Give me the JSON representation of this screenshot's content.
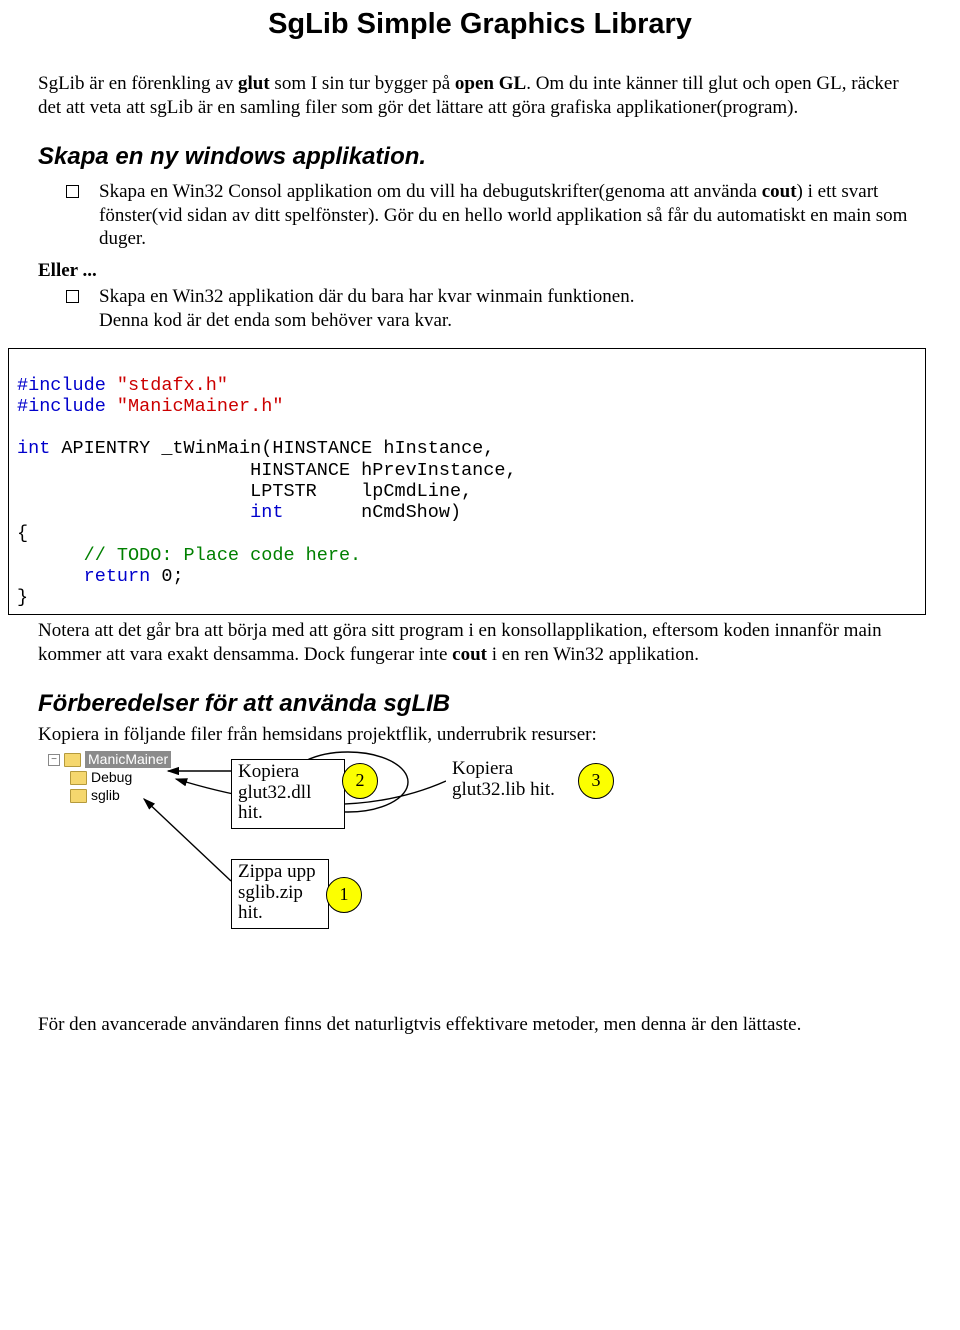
{
  "title": "SgLib Simple Graphics Library",
  "intro_pre": "SgLib är en förenkling av ",
  "intro_b1": "glut",
  "intro_mid1": " som I sin tur bygger på ",
  "intro_b2": "open GL",
  "intro_mid2": ". Om du inte känner till glut och open GL, räcker det att veta att sgLib är en samling filer som gör det lättare att göra grafiska applikationer(program).",
  "heading1": "Skapa en ny windows applikation.",
  "bullet1_pre": "Skapa en Win32 Consol applikation om du vill ha debugutskrifter(genoma att använda ",
  "bullet1_b": "cout",
  "bullet1_post": ") i ett svart fönster(vid sidan av ditt spelfönster). Gör du en hello world applikation så får du automatiskt en main som duger.",
  "eller_label": "Eller",
  "eller_dots": " ...",
  "bullet2_line1": "Skapa en Win32 applikation där du bara har kvar winmain funktionen.",
  "bullet2_line2": "Denna kod är det enda som behöver vara kvar.",
  "code": {
    "inc": "#include",
    "q1": " \"stdafx.h\"",
    "q2": " \"ManicMainer.h\"",
    "int_kw": "int",
    "api": " APIENTRY _tWinMain(HINSTANCE hInstance,",
    "l2": "                     HINSTANCE hPrevInstance,",
    "l3a": "                     LPTSTR    lpCmdLine,",
    "l4a": "                     ",
    "l4b": "int",
    "l4c": "       nCmdShow)",
    "brace_o": "{",
    "comment": "      // TODO: Place code here.",
    "ret_a": "      ",
    "ret_b": "return",
    "ret_c": " 0;",
    "brace_c": "}"
  },
  "after_code_pre": "Notera att det går bra att börja med att göra sitt program i en konsollapplikation, eftersom koden innanför main kommer att vara exakt densamma. Dock fungerar inte ",
  "after_code_b": "cout",
  "after_code_post": " i en ren Win32 applikation.",
  "heading2": "Förberedelser för att använda sgLIB",
  "prep_intro": "Kopiera in följande filer från hemsidans projektflik, underrubrik resurser:",
  "tree": {
    "root": "ManicMainer",
    "child1": "Debug",
    "child2": "sglib"
  },
  "anno": {
    "k1": "Kopiera glut32.dll hit.",
    "k2": "Kopiera glut32.lib hit.",
    "k3": "Zippa upp sglib.zip hit."
  },
  "circles": {
    "n1": "1",
    "n2": "2",
    "n3": "3"
  },
  "final": "För den avancerade användaren finns det naturligtvis effektivare metoder, men denna är den lättaste."
}
